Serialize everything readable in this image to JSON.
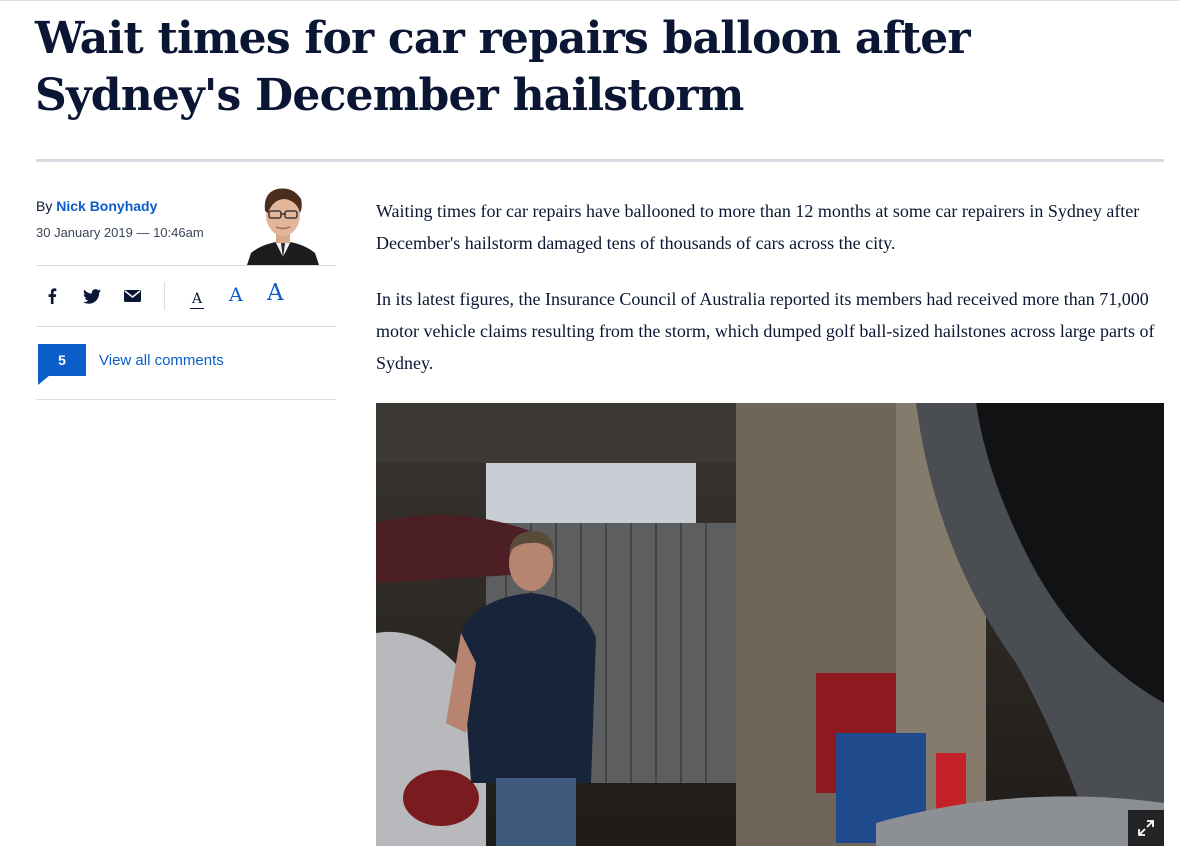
{
  "article": {
    "headline": "Wait times for car repairs balloon after Sydney's December hailstorm",
    "byline_prefix": "By",
    "author": "Nick Bonyhady",
    "date": "30 January 2019 — 10:46am",
    "paragraphs": [
      "Waiting times for car repairs have ballooned to more than 12 months at some car repairers in Sydney after December's hailstorm damaged tens of thousands of cars across the city.",
      "In its latest figures, the Insurance Council of Australia reported its members had received more than 71,000 motor vehicle claims resulting from the storm, which dumped golf ball-sized hailstones  across large parts of Sydney."
    ]
  },
  "share": {
    "icons": [
      "facebook-icon",
      "twitter-icon",
      "email-icon"
    ]
  },
  "font_size": {
    "small": "A",
    "medium": "A",
    "large": "A"
  },
  "comments": {
    "count": "5",
    "link_label": "View all comments"
  },
  "colors": {
    "headline": "#0a1633",
    "link": "#0b5ec9",
    "rule": "#d5dae2"
  }
}
